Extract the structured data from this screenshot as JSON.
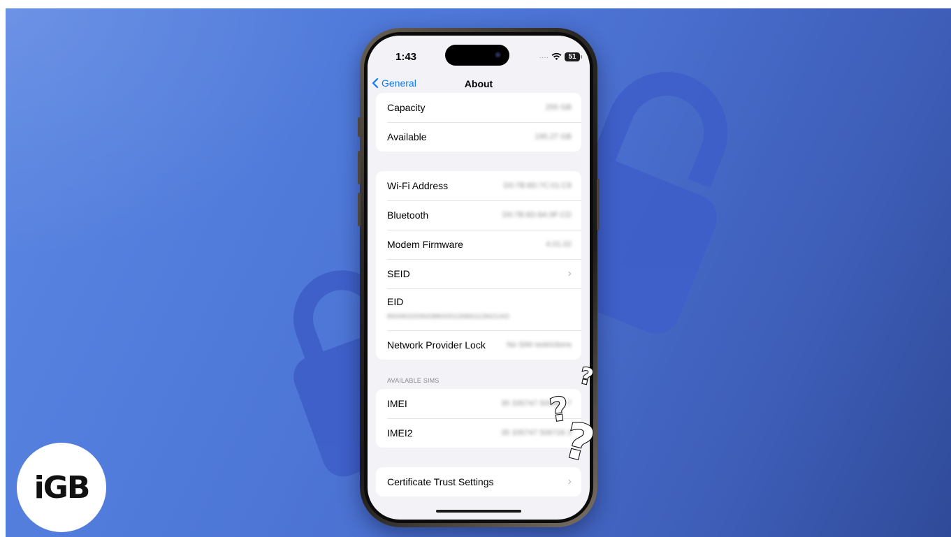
{
  "status_bar": {
    "time": "1:43",
    "battery": "51"
  },
  "nav": {
    "back_label": "General",
    "title": "About"
  },
  "storage_group": [
    {
      "label": "Capacity",
      "value": "255 GB"
    },
    {
      "label": "Available",
      "value": "195.27 GB"
    }
  ],
  "network_group": [
    {
      "label": "Wi-Fi Address",
      "value": "D0:7B:6D:7C:01:C8"
    },
    {
      "label": "Bluetooth",
      "value": "D0:7B:6D:8A:9F:CD"
    },
    {
      "label": "Modem Firmware",
      "value": "4.01.02"
    },
    {
      "label": "SEID"
    },
    {
      "label": "EID",
      "value": "89049032006008800001268661128421443"
    },
    {
      "label": "Network Provider Lock",
      "value": "No SIM restrictions"
    }
  ],
  "sims_group": {
    "header": "AVAILABLE SIMS",
    "rows": [
      {
        "label": "IMEI",
        "value": "35 335747 509483 7"
      },
      {
        "label": "IMEI2",
        "value": "35 335747 506726 3"
      }
    ]
  },
  "trust_group": {
    "label": "Certificate Trust Settings"
  },
  "logo": {
    "text": "iGB"
  },
  "colors": {
    "accent": "#0a7aff",
    "background": "#4f79d9",
    "lock": "#3f5fc9"
  },
  "icons": {
    "back": "chevron-left-icon",
    "wifi": "wifi-icon",
    "chevron": "chevron-right-icon"
  }
}
